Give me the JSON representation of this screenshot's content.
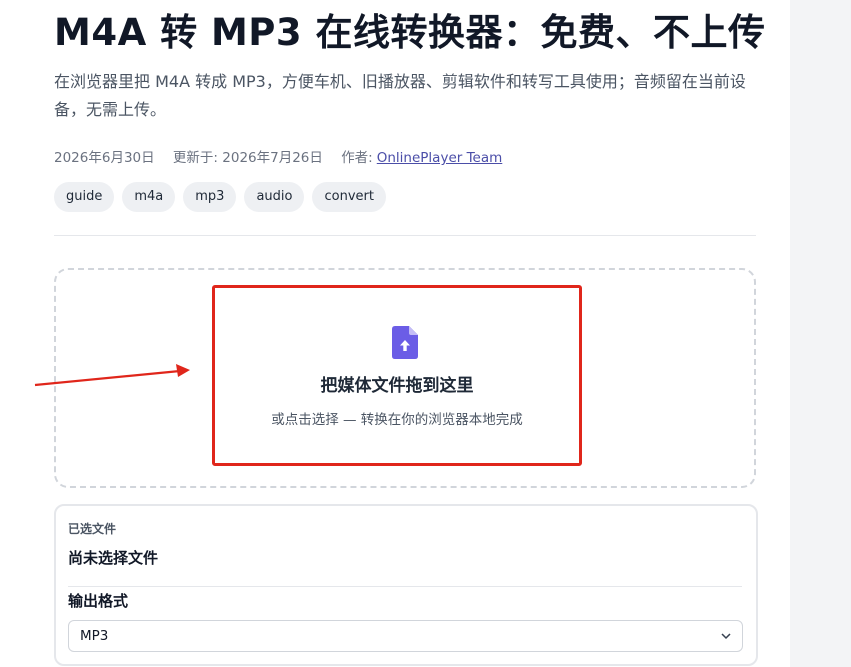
{
  "article": {
    "title": "M4A 转 MP3 在线转换器：免费、不上传",
    "description": "在浏览器里把 M4A 转成 MP3，方便车机、旧播放器、剪辑软件和转写工具使用；音频留在当前设备，无需上传。",
    "published": "2026年6月30日",
    "updated": "更新于: 2026年7月26日",
    "author_prefix": "作者:",
    "author_link": "OnlinePlayer Team",
    "tags": [
      "guide",
      "m4a",
      "mp3",
      "audio",
      "convert"
    ]
  },
  "dropzone": {
    "title": "把媒体文件拖到这里",
    "subtitle": "或点击选择 — 转换在你的浏览器本地完成"
  },
  "file_panel": {
    "selected_label": "已选文件",
    "selected_value": "尚未选择文件",
    "format_label": "输出格式",
    "format_value": "MP3"
  },
  "colors": {
    "accent": "#6b5de6",
    "highlight_box": "#e0261b",
    "link": "#4b4ea8"
  },
  "icons": {
    "upload": "file-upload-icon",
    "chevron": "chevron-down-icon"
  }
}
